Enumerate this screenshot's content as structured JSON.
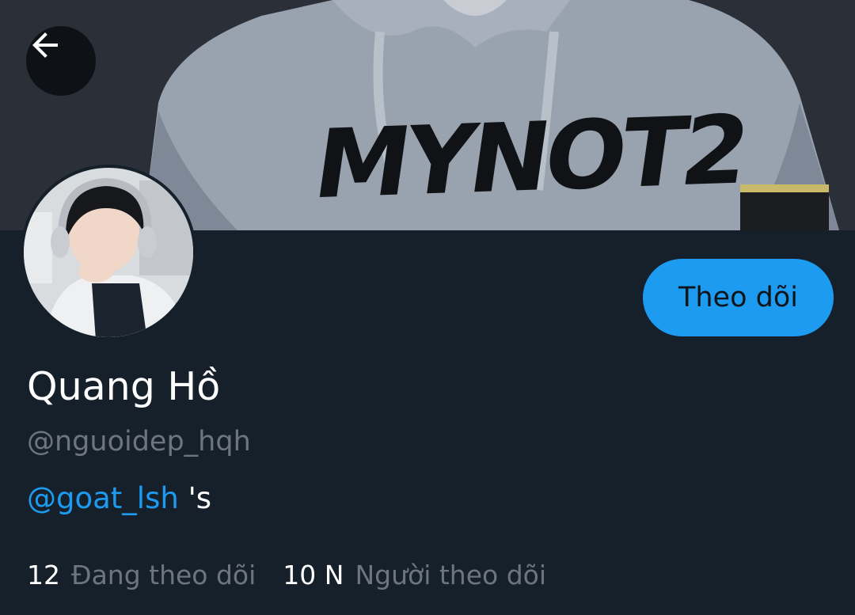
{
  "header": {
    "back_icon": "arrow-left-icon",
    "banner_text": "MYNOT2"
  },
  "profile": {
    "display_name": "Quang Hồ",
    "handle": "@nguoidep_hqh",
    "bio_mention": "@goat_lsh",
    "bio_suffix": " 's",
    "follow_button_label": "Theo dõi"
  },
  "stats": {
    "following_count": "12",
    "following_label": "Đang theo dõi",
    "followers_count": "10 N",
    "followers_label": "Người theo dõi"
  },
  "colors": {
    "background": "#15202b",
    "accent": "#1d9bf0",
    "secondary_text": "#6e767d",
    "primary_text": "#ffffff"
  }
}
